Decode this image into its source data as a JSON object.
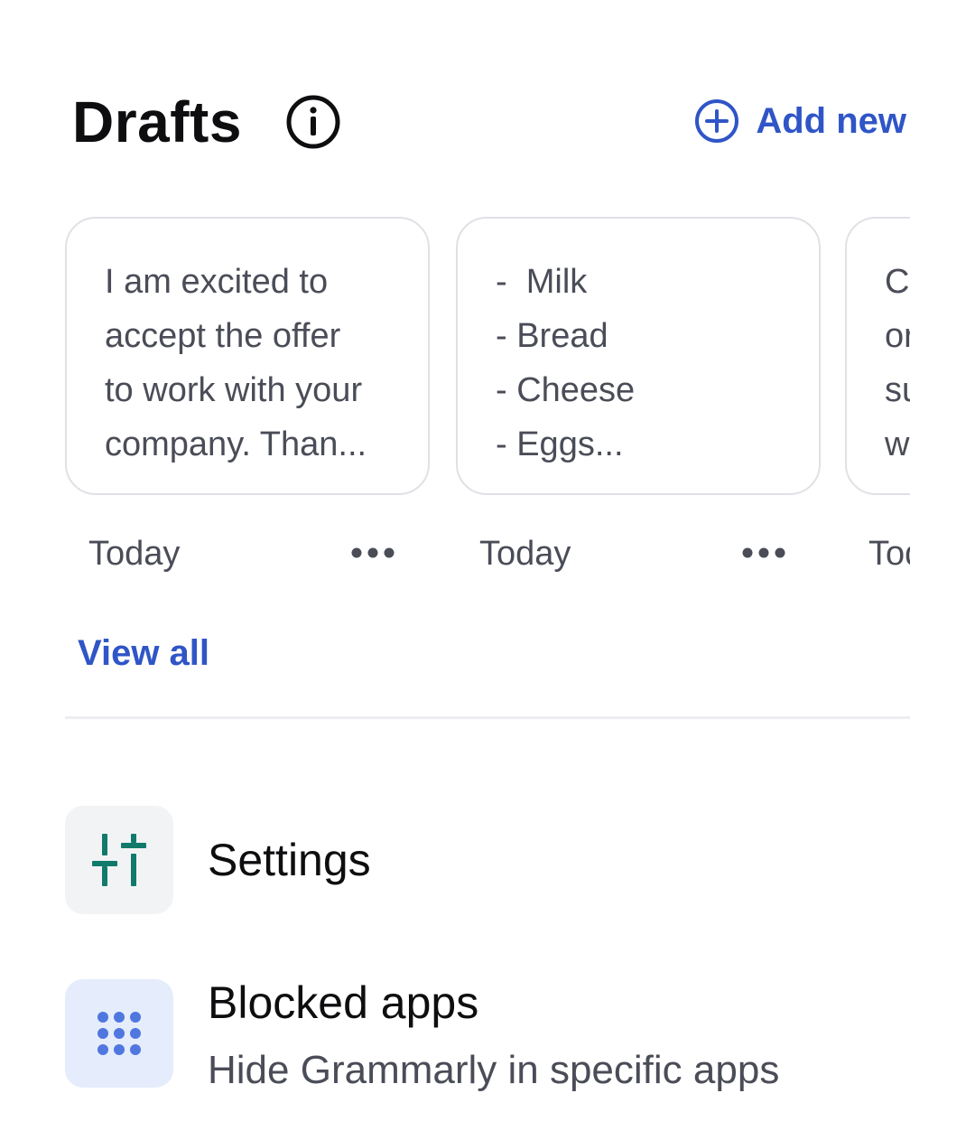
{
  "header": {
    "title": "Drafts",
    "add_new_label": "Add new"
  },
  "drafts": [
    {
      "text": "I am excited to\naccept the offer\nto work with your\ncompany. Than...",
      "date": "Today"
    },
    {
      "text": "-  Milk\n- Bread\n- Cheese\n- Eggs...",
      "date": "Today"
    },
    {
      "text": "Cc\nor\nsu\nwi",
      "date": "Today"
    }
  ],
  "view_all_label": "View all",
  "menu": {
    "settings": {
      "title": "Settings"
    },
    "blocked_apps": {
      "title": "Blocked apps",
      "subtitle": "Hide Grammarly in specific apps"
    }
  },
  "colors": {
    "accent": "#2f55c7",
    "settings_icon_bg": "#f2f3f5",
    "settings_icon": "#117a6b",
    "blocked_icon_bg": "#e5ecfc",
    "blocked_icon": "#5077e0"
  },
  "icons": {
    "info": "info-icon",
    "add": "plus-circle-icon",
    "more": "more-horizontal-icon",
    "settings": "sliders-icon",
    "blocked_apps": "grid-dots-icon"
  }
}
